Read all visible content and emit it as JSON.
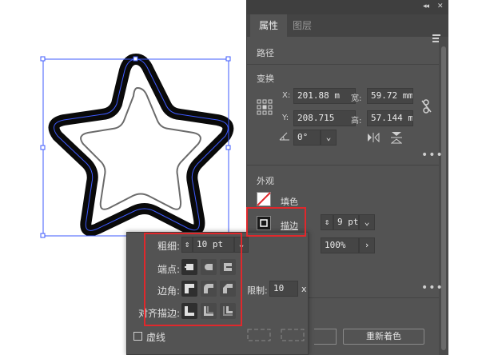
{
  "panel": {
    "collapse_label": "◂◂",
    "close_label": "✕",
    "tabs": [
      {
        "label": "属性",
        "active": true
      },
      {
        "label": "图层",
        "active": false
      }
    ]
  },
  "path_section": {
    "title": "路径"
  },
  "transform": {
    "title": "变换",
    "x_label": "X:",
    "x_value": "201.88 m",
    "y_label": "Y:",
    "y_value": "208.715",
    "w_label": "宽:",
    "w_value": "59.72 mm",
    "h_label": "高:",
    "h_value": "57.144 m",
    "angle_value": "0°"
  },
  "appearance": {
    "title": "外观",
    "fill_label": "填色",
    "stroke_label": "描边",
    "stroke_weight": "9 pt",
    "opacity": "100%"
  },
  "stroke_popup": {
    "weight_label": "粗细:",
    "weight_value": "10 pt",
    "cap_label": "端点:",
    "corner_label": "边角:",
    "limit_label": "限制:",
    "limit_value": "10",
    "limit_unit": "x",
    "align_label": "对齐描边:",
    "dashed_label": "虚线"
  },
  "buttons": {
    "recolor_label": "重新着色"
  },
  "colors": {
    "accent_red": "#e0282c",
    "panel_bg": "#535353",
    "selection_blue": "#3d5afe"
  }
}
